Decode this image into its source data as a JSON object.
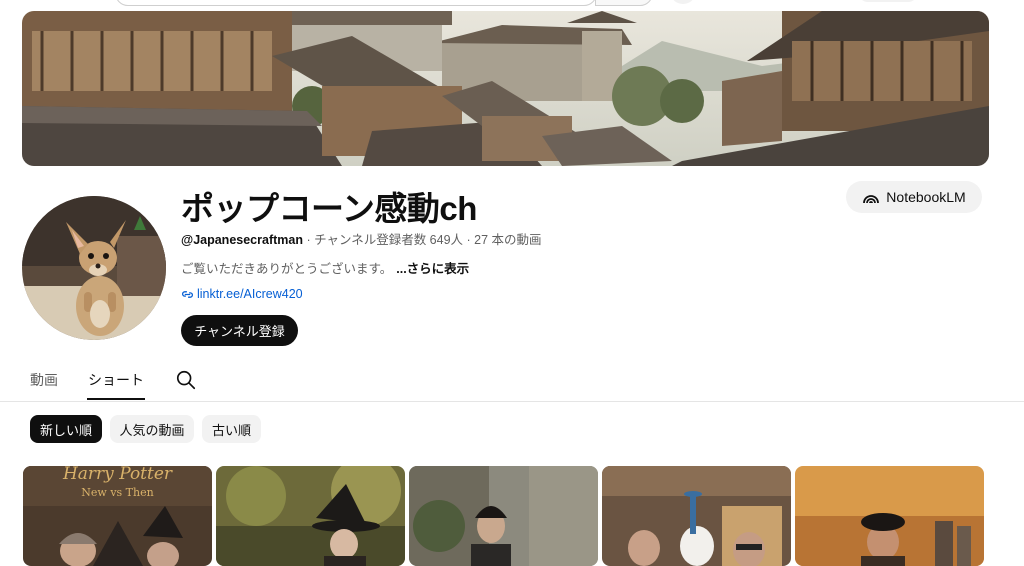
{
  "channel": {
    "name": "ポップコーン感動ch",
    "handle": "@Japanesecraftman",
    "stats": " · チャンネル登録者数 649人 · 27 本の動画",
    "description": "ご覧いただきありがとうございます。",
    "more_label": "...さらに表示",
    "link": "linktr.ee/AIcrew420",
    "subscribe_label": "チャンネル登録"
  },
  "notebooklm_label": "NotebookLM",
  "tabs": [
    {
      "label": "動画",
      "active": false
    },
    {
      "label": "ショート",
      "active": true
    }
  ],
  "chips": [
    {
      "label": "新しい順",
      "active": true
    },
    {
      "label": "人気の動画",
      "active": false
    },
    {
      "label": "古い順",
      "active": false
    }
  ],
  "thumbnails": [
    {
      "caption_title": "Harry Potter",
      "caption_sub": "New vs Then"
    },
    {
      "caption_title": "",
      "caption_sub": ""
    },
    {
      "caption_title": "",
      "caption_sub": ""
    },
    {
      "caption_title": "",
      "caption_sub": ""
    },
    {
      "caption_title": "",
      "caption_sub": ""
    }
  ],
  "icons": {
    "link": "link-icon",
    "search": "search-icon",
    "notebooklm": "notebooklm-icon"
  }
}
